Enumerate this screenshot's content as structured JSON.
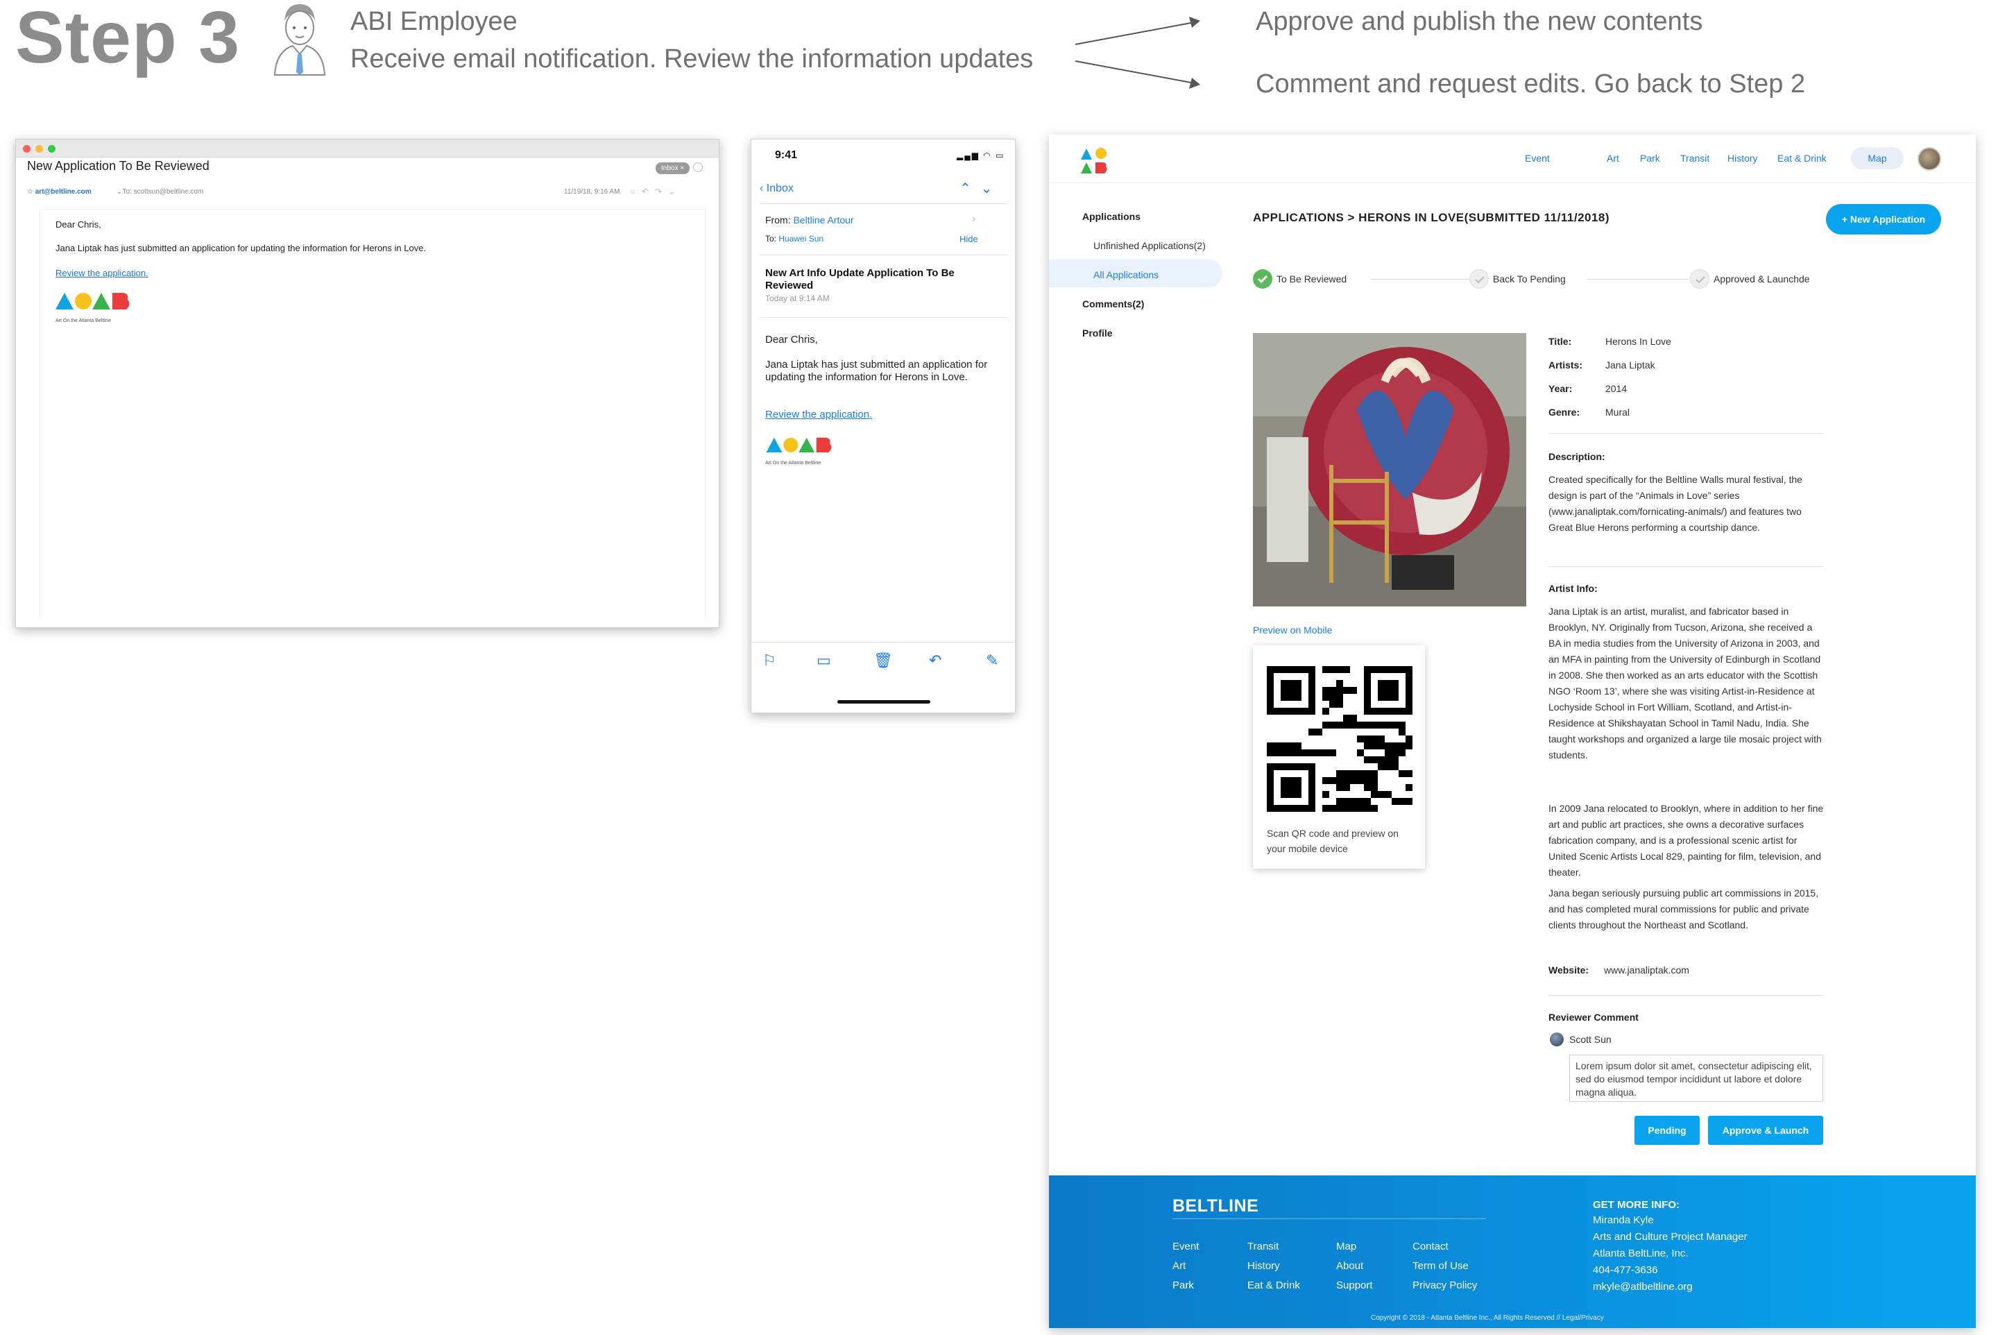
{
  "header": {
    "step": "Step 3",
    "role": "ABI Employee",
    "description": "Receive email notification. Review the information updates",
    "option_approve": "Approve and publish the new contents",
    "option_comment": "Comment and request edits. Go back to Step 2"
  },
  "desktop_mail": {
    "subject": "New Application To Be Reviewed",
    "mailbox_badge": "Inbox ×",
    "from": "art@beltline.com",
    "to": "To: scottsun@beltline.com",
    "date": "11/19/18, 9:16 AM",
    "greeting": "Dear Chris,",
    "body": "Jana Liptak has just submitted an application for updating the information for Herons in Love.",
    "link": "Review the application.",
    "logo_caption": "Art On the Atlanta Beltline"
  },
  "phone_mail": {
    "time": "9:41",
    "back_label": "Inbox",
    "from_label": "From:",
    "from_name": "Beltline Artour",
    "to_label": "To:",
    "to_name": "Huawei Sun",
    "hide_label": "Hide",
    "title": "New Art Info Update Application To Be Reviewed",
    "date": "Today at 9:14 AM",
    "greeting": "Dear Chris,",
    "body": "Jana Liptak has just submitted an application for updating the information for Herons in Love.",
    "link": "Review the application.",
    "logo_caption": "Art On the Atlanta Beltline"
  },
  "web": {
    "nav": [
      "Event",
      "Art",
      "Park",
      "Transit",
      "History",
      "Eat & Drink"
    ],
    "map_label": "Map",
    "sidebar": {
      "applications": "Applications",
      "unfinished": "Unfinished Applications(2)",
      "all": "All Applications",
      "comments": "Comments(2)",
      "profile": "Profile"
    },
    "breadcrumb": "APPLICATIONS  >  HERONS IN LOVE(SUBMITTED 11/11/2018)",
    "new_button": "+ New Application",
    "steps": [
      "To Be Reviewed",
      "Back To Pending",
      "Approved & Launchde"
    ],
    "preview_link": "Preview on Mobile",
    "qr_caption": "Scan QR code and preview on your mobile device",
    "fields": {
      "title_label": "Title:",
      "title": "Herons In Love",
      "artists_label": "Artists:",
      "artists": "Jana Liptak",
      "year_label": "Year:",
      "year": "2014",
      "genre_label": "Genre:",
      "genre": "Mural"
    },
    "description_label": "Description:",
    "description": "Created specifically for the Beltline Walls mural festival, the design is part of the “Animals in Love” series (www.janaliptak.com/fornicating-animals/) and features two Great Blue Herons performing a courtship dance.",
    "artist_info_label": "Artist Info:",
    "artist_info_1": "Jana Liptak is an artist, muralist, and fabricator based in Brooklyn, NY. Originally from Tucson, Arizona, she received a BA in media studies from the University of Arizona in 2003, and an MFA in painting from the University of Edinburgh in Scotland in 2008. She then worked as an arts educator with the Scottish NGO ‘Room 13’, where she was visiting Artist-in-Residence at Lochyside School in Fort William, Scotland, and Artist-in-Residence at Shikshayatan School in Tamil Nadu, India. She taught workshops and organized a large tile mosaic project with students.",
    "artist_info_2": "In 2009 Jana relocated to Brooklyn, where in addition to her fine art and public art practices, she owns a decorative surfaces fabrication company, and is a professional scenic artist for United Scenic Artists Local 829, painting for film, television, and theater.",
    "artist_info_3": "Jana began seriously pursuing public art commissions in 2015, and has completed mural commissions for public and private clients throughout the Northeast and Scotland.",
    "website_label": "Website:",
    "website": "www.janaliptak.com",
    "reviewer_label": "Reviewer Comment",
    "reviewer_name": "Scott Sun",
    "comment": "Lorem ipsum dolor sit amet, consectetur adipiscing elit, sed do eiusmod tempor incididunt ut labore et dolore magna aliqua.",
    "pending_button": "Pending",
    "approve_button": "Approve & Launch",
    "footer": {
      "brand": "BELTLINE",
      "col1": [
        "Event",
        "Art",
        "Park"
      ],
      "col2": [
        "Transit",
        "History",
        "Eat & Drink"
      ],
      "col3": [
        "Map",
        "About",
        "Support"
      ],
      "col4": [
        "Contact",
        "Term of Use",
        "Privacy Policy"
      ],
      "more_info_label": "GET MORE INFO:",
      "contact": [
        "Miranda Kyle",
        "Arts and Culture Project Manager",
        "Atlanta BeltLine, Inc.",
        "404-477-3636",
        "mkyle@atlbeltline.org"
      ],
      "copyright": "Copyright © 2018 - Atlanta Beltline Inc., All Rights Reserved // Legal/Privacy"
    }
  },
  "colors": {
    "accent": "#0aa3ee",
    "link": "#1a7cf2",
    "step_done": "#5cb85c",
    "header_gray": "#8c8c8c"
  }
}
